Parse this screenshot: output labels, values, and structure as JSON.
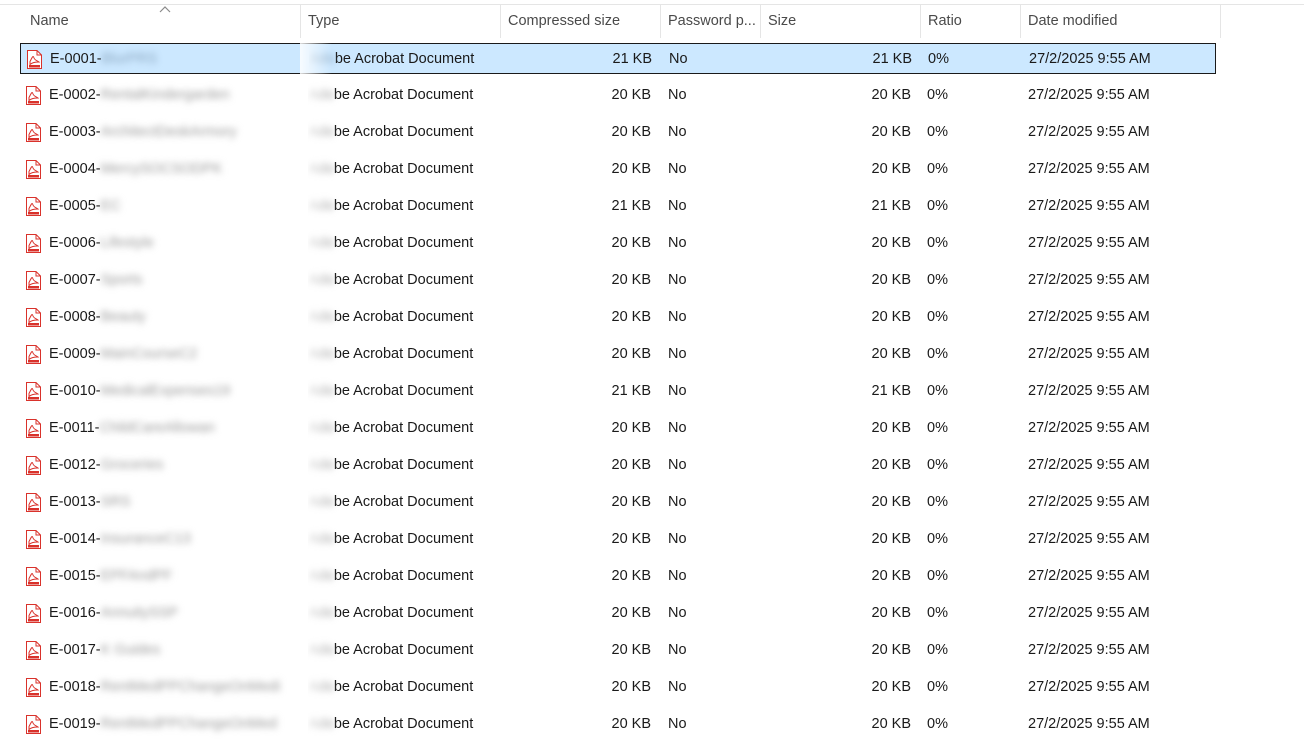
{
  "columns": {
    "name": "Name",
    "type": "Type",
    "compressed_size": "Compressed size",
    "password": "Password p...",
    "size": "Size",
    "ratio": "Ratio",
    "date_modified": "Date modified"
  },
  "sort": {
    "column": "name",
    "direction": "ascending",
    "icon": "sort-up-arrow"
  },
  "rows": [
    {
      "id": "E-0001-",
      "hidden": "BlurPRS",
      "type": "be Acrobat Document",
      "type_prefix": "Ado",
      "compressed": "21 KB",
      "password": "No",
      "size": "21 KB",
      "ratio": "0%",
      "date": "27/2/2025 9:55 AM",
      "selected": true
    },
    {
      "id": "E-0002-",
      "hidden": "RentalKindergarden",
      "type": "be Acrobat Document",
      "type_prefix": "Ado",
      "compressed": "20 KB",
      "password": "No",
      "size": "20 KB",
      "ratio": "0%",
      "date": "27/2/2025 9:55 AM"
    },
    {
      "id": "E-0003-",
      "hidden": "ArchitectDeskArmory",
      "type": "be Acrobat Document",
      "type_prefix": "Ado",
      "compressed": "20 KB",
      "password": "No",
      "size": "20 KB",
      "ratio": "0%",
      "date": "27/2/2025 9:55 AM"
    },
    {
      "id": "E-0004-",
      "hidden": "MercySOCSODPK",
      "type": "be Acrobat Document",
      "type_prefix": "Ado",
      "compressed": "20 KB",
      "password": "No",
      "size": "20 KB",
      "ratio": "0%",
      "date": "27/2/2025 9:55 AM"
    },
    {
      "id": "E-0005-",
      "hidden": "EC",
      "type": "be Acrobat Document",
      "type_prefix": "Ado",
      "compressed": "21 KB",
      "password": "No",
      "size": "21 KB",
      "ratio": "0%",
      "date": "27/2/2025 9:55 AM"
    },
    {
      "id": "E-0006-",
      "hidden": "Lifestyle",
      "type": "be Acrobat Document",
      "type_prefix": "Ado",
      "compressed": "20 KB",
      "password": "No",
      "size": "20 KB",
      "ratio": "0%",
      "date": "27/2/2025 9:55 AM"
    },
    {
      "id": "E-0007-",
      "hidden": "Sports",
      "type": "be Acrobat Document",
      "type_prefix": "Ado",
      "compressed": "20 KB",
      "password": "No",
      "size": "20 KB",
      "ratio": "0%",
      "date": "27/2/2025 9:55 AM"
    },
    {
      "id": "E-0008-",
      "hidden": "Beauty",
      "type": "be Acrobat Document",
      "type_prefix": "Ado",
      "compressed": "20 KB",
      "password": "No",
      "size": "20 KB",
      "ratio": "0%",
      "date": "27/2/2025 9:55 AM"
    },
    {
      "id": "E-0009-",
      "hidden": "MainCourseC2",
      "type": "be Acrobat Document",
      "type_prefix": "Ado",
      "compressed": "20 KB",
      "password": "No",
      "size": "20 KB",
      "ratio": "0%",
      "date": "27/2/2025 9:55 AM"
    },
    {
      "id": "E-0010-",
      "hidden": "MedicalExpenses19",
      "type": "be Acrobat Document",
      "type_prefix": "Ado",
      "compressed": "21 KB",
      "password": "No",
      "size": "21 KB",
      "ratio": "0%",
      "date": "27/2/2025 9:55 AM"
    },
    {
      "id": "E-0011-",
      "hidden": "ChildCareAllowan",
      "type": "be Acrobat Document",
      "type_prefix": "Ado",
      "compressed": "20 KB",
      "password": "No",
      "size": "20 KB",
      "ratio": "0%",
      "date": "27/2/2025 9:55 AM"
    },
    {
      "id": "E-0012-",
      "hidden": "Groceries",
      "type": "be Acrobat Document",
      "type_prefix": "Ado",
      "compressed": "20 KB",
      "password": "No",
      "size": "20 KB",
      "ratio": "0%",
      "date": "27/2/2025 9:55 AM"
    },
    {
      "id": "E-0013-",
      "hidden": "SRS",
      "type": "be Acrobat Document",
      "type_prefix": "Ado",
      "compressed": "20 KB",
      "password": "No",
      "size": "20 KB",
      "ratio": "0%",
      "date": "27/2/2025 9:55 AM"
    },
    {
      "id": "E-0014-",
      "hidden": "InsuranceC13",
      "type": "be Acrobat Document",
      "type_prefix": "Ado",
      "compressed": "20 KB",
      "password": "No",
      "size": "20 KB",
      "ratio": "0%",
      "date": "27/2/2025 9:55 AM"
    },
    {
      "id": "E-0015-",
      "hidden": "EPFAndPF",
      "type": "be Acrobat Document",
      "type_prefix": "Ado",
      "compressed": "20 KB",
      "password": "No",
      "size": "20 KB",
      "ratio": "0%",
      "date": "27/2/2025 9:55 AM"
    },
    {
      "id": "E-0016-",
      "hidden": "AnnuitySSP",
      "type": "be Acrobat Document",
      "type_prefix": "Ado",
      "compressed": "20 KB",
      "password": "No",
      "size": "20 KB",
      "ratio": "0%",
      "date": "27/2/2025 9:55 AM"
    },
    {
      "id": "E-0017-",
      "hidden": "K Guides",
      "type": "be Acrobat Document",
      "type_prefix": "Ado",
      "compressed": "20 KB",
      "password": "No",
      "size": "20 KB",
      "ratio": "0%",
      "date": "27/2/2025 9:55 AM"
    },
    {
      "id": "E-0018-",
      "hidden": "RentMedPPChangeOnMedi",
      "type": "be Acrobat Document",
      "type_prefix": "Ado",
      "compressed": "20 KB",
      "password": "No",
      "size": "20 KB",
      "ratio": "0%",
      "date": "27/2/2025 9:55 AM"
    },
    {
      "id": "E-0019-",
      "hidden": "RentMedPPChangeOnMed",
      "type": "be Acrobat Document",
      "type_prefix": "Ado",
      "compressed": "20 KB",
      "password": "No",
      "size": "20 KB",
      "ratio": "0%",
      "date": "27/2/2025 9:55 AM"
    }
  ],
  "colors": {
    "selection_bg": "#cce8ff",
    "selection_border": "#1a1a1a",
    "pdf_red": "#d9322b"
  },
  "icons": {
    "file_icon": "pdf-file-icon"
  }
}
